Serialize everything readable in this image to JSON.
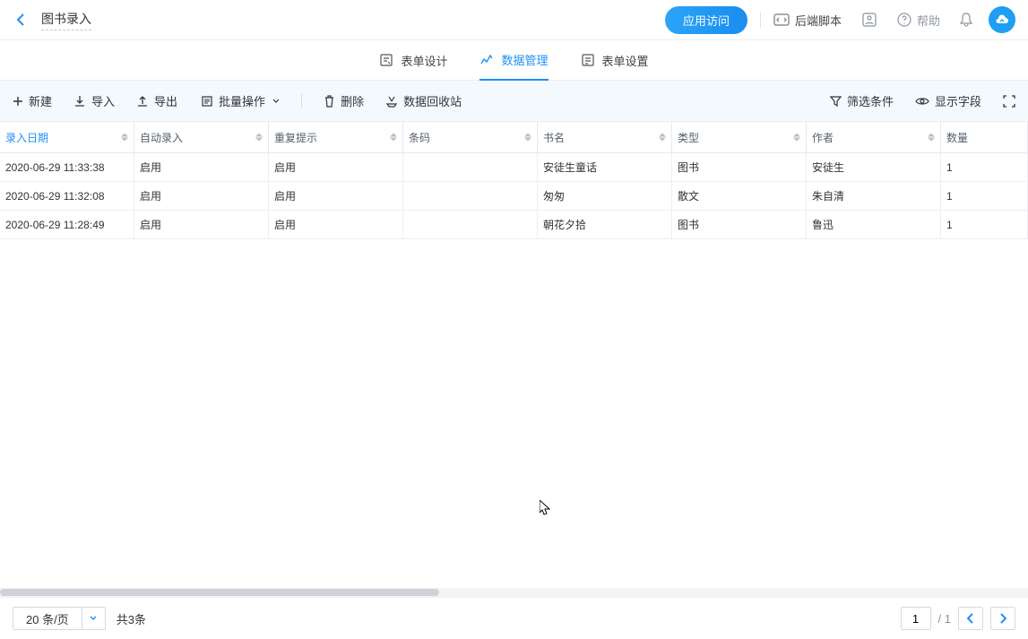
{
  "header": {
    "title": "图书录入",
    "app_access": "应用访问",
    "backend_script": "后端脚本",
    "help": "帮助"
  },
  "tabs": {
    "form_design": "表单设计",
    "data_mgmt": "数据管理",
    "form_settings": "表单设置"
  },
  "toolbar": {
    "new": "新建",
    "import": "导入",
    "export": "导出",
    "batch": "批量操作",
    "delete": "删除",
    "recycle": "数据回收站",
    "filter": "筛选条件",
    "fields": "显示字段"
  },
  "columns": [
    "录入日期",
    "自动录入",
    "重复提示",
    "条码",
    "书名",
    "类型",
    "作者",
    "数量"
  ],
  "rows": [
    {
      "c0": "2020-06-29 11:33:38",
      "c1": "启用",
      "c2": "启用",
      "c3": "",
      "c4": "安徒生童话",
      "c5": "图书",
      "c6": "安徒生",
      "c7": "1"
    },
    {
      "c0": "2020-06-29 11:32:08",
      "c1": "启用",
      "c2": "启用",
      "c3": "",
      "c4": "匆匆",
      "c5": "散文",
      "c6": "朱自清",
      "c7": "1"
    },
    {
      "c0": "2020-06-29 11:28:49",
      "c1": "启用",
      "c2": "启用",
      "c3": "",
      "c4": "朝花夕拾",
      "c5": "图书",
      "c6": "鲁迅",
      "c7": "1"
    }
  ],
  "footer": {
    "pagesize": "20 条/页",
    "total": "共3条",
    "page_current": "1",
    "page_total": "/ 1"
  }
}
